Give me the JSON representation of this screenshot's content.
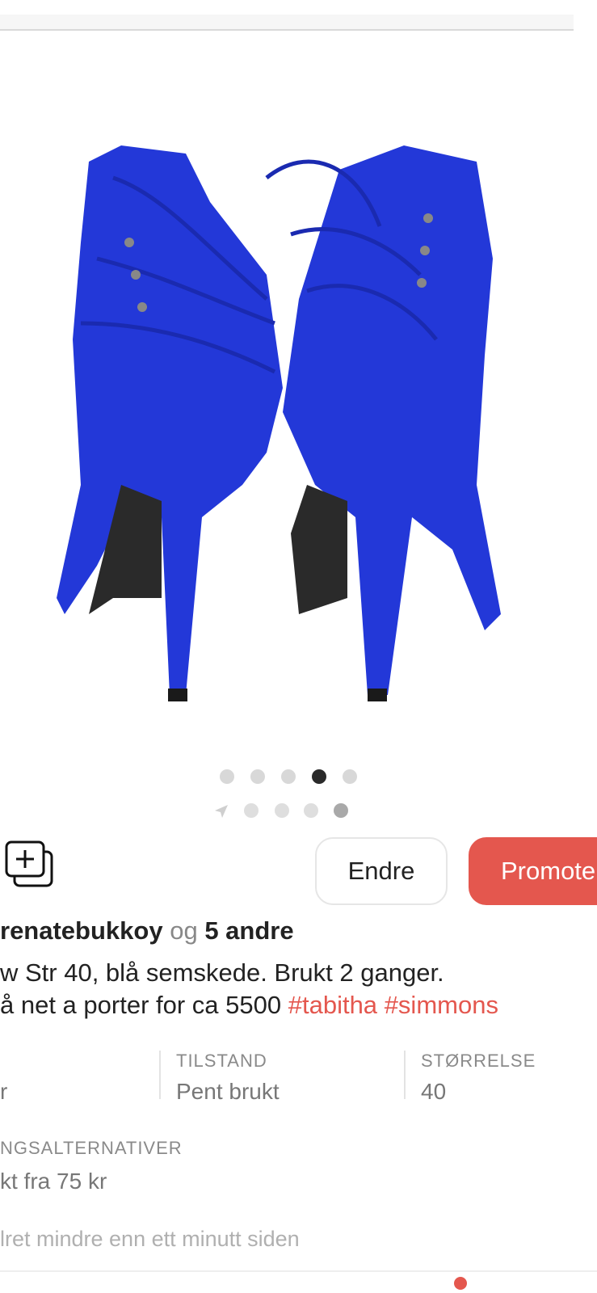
{
  "listing": {
    "image_dots": {
      "count": 5,
      "active_index": 3
    },
    "mini_dots": {
      "count": 4
    },
    "actions": {
      "edit_label": "Endre",
      "promote_label": "Promote"
    },
    "likes": {
      "user": "renatebukkoy",
      "connector": "og",
      "others": "5 andre"
    },
    "description": {
      "line1": "w Str 40, blå semskede. Brukt 2 ganger.",
      "line2_text": "å net a porter for ca 5500 ",
      "tags": [
        "#tabitha",
        "#simmons"
      ]
    },
    "attributes": [
      {
        "label": "",
        "value": "r"
      },
      {
        "label": "TILSTAND",
        "value": "Pent brukt"
      },
      {
        "label": "STØRRELSE",
        "value": "40"
      }
    ],
    "shipping": {
      "label": "NGSALTERNATIVER",
      "value": "kt fra 75 kr"
    },
    "posted": "lret mindre enn ett minutt siden"
  },
  "colors": {
    "accent": "#e4574e",
    "shoe_blue": "#2338d8"
  },
  "icons": {
    "save": "add-to-collection-icon",
    "location": "location-arrow-icon"
  }
}
